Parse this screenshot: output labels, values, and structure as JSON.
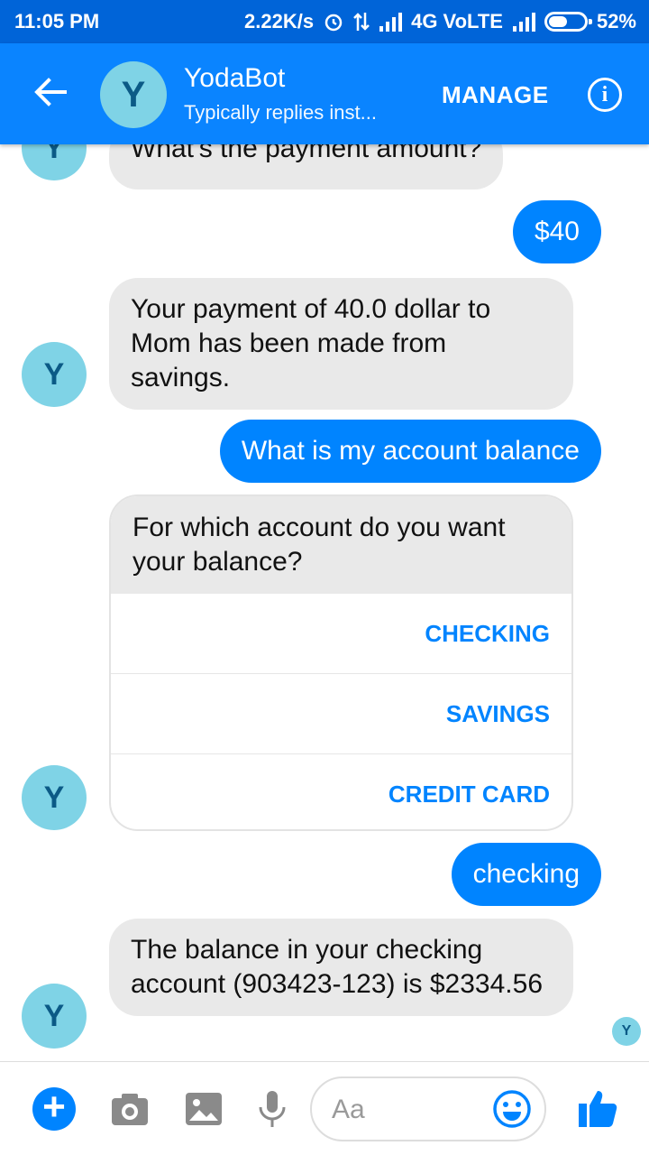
{
  "status_bar": {
    "time": "11:05 PM",
    "net_speed": "2.22K/s",
    "network": "4G VoLTE",
    "battery": "52%",
    "battery_level": 0.52
  },
  "header": {
    "avatar_letter": "Y",
    "title": "YodaBot",
    "subtitle": "Typically replies inst...",
    "manage_label": "MANAGE",
    "info_glyph": "i"
  },
  "avatar_letter": "Y",
  "messages": [
    {
      "from": "bot",
      "text": "What's the payment amount?"
    },
    {
      "from": "user",
      "text": "$40"
    },
    {
      "from": "bot",
      "text": "Your payment of 40.0 dollar to Mom has been made from savings."
    },
    {
      "from": "user",
      "text": "What is my account balance"
    },
    {
      "from": "bot",
      "text": "For which account do you want your balance?"
    },
    {
      "from": "user",
      "text": "checking"
    },
    {
      "from": "bot",
      "text": "The balance in your checking account (903423-123) is $2334.56"
    }
  ],
  "quick_replies": [
    "CHECKING",
    "SAVINGS",
    "CREDIT CARD"
  ],
  "seen_letter": "Y",
  "composer": {
    "plus_glyph": "+",
    "placeholder": "Aa"
  },
  "colors": {
    "header": "#0a84ff",
    "status_bar": "#0064d8",
    "user_bubble": "#0084ff",
    "bot_bubble": "#e9e9e9",
    "avatar": "#7fd3e6"
  }
}
